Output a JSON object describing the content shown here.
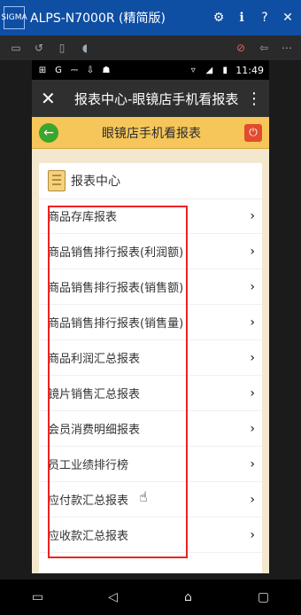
{
  "emulator": {
    "title": "ALPS-N7000R (精简版)",
    "logo_text": "SIGMA"
  },
  "status": {
    "time": "11:49"
  },
  "app": {
    "title": "报表中心-眼镜店手机看报表",
    "sub_title": "眼镜店手机看报表"
  },
  "card": {
    "title": "报表中心"
  },
  "reports": [
    {
      "label": "商品存库报表"
    },
    {
      "label": "商品销售排行报表(利润额)"
    },
    {
      "label": "商品销售排行报表(销售额)"
    },
    {
      "label": "商品销售排行报表(销售量)"
    },
    {
      "label": "商品利润汇总报表"
    },
    {
      "label": "镜片销售汇总报表"
    },
    {
      "label": "会员消费明细报表"
    },
    {
      "label": "员工业绩排行榜"
    },
    {
      "label": "应付款汇总报表"
    },
    {
      "label": "应收款汇总报表"
    }
  ],
  "icons": {
    "chevron": "chevron-right-icon",
    "back": "back-arrow-icon",
    "power": "power-icon"
  },
  "colors": {
    "accent": "#f6c65a",
    "highlight": "#e22222",
    "emulator_title": "#0e4ea3"
  }
}
